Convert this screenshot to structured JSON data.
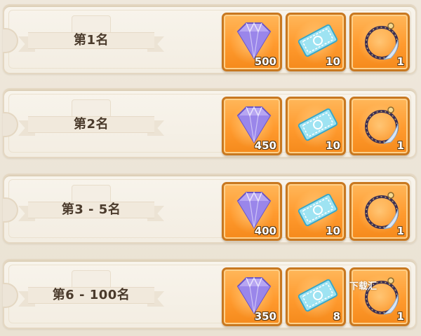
{
  "tiers": [
    {
      "rank": "第1名",
      "rewards": [
        {
          "item": "gem",
          "icon": "crystal-gem-icon",
          "quantity": "500"
        },
        {
          "item": "ticket",
          "icon": "ticket-icon",
          "quantity": "10"
        },
        {
          "item": "charm",
          "icon": "ring-charm-icon",
          "quantity": "1"
        }
      ]
    },
    {
      "rank": "第2名",
      "rewards": [
        {
          "item": "gem",
          "icon": "crystal-gem-icon",
          "quantity": "450"
        },
        {
          "item": "ticket",
          "icon": "ticket-icon",
          "quantity": "10"
        },
        {
          "item": "charm",
          "icon": "ring-charm-icon",
          "quantity": "1"
        }
      ]
    },
    {
      "rank": "第3 - 5名",
      "rewards": [
        {
          "item": "gem",
          "icon": "crystal-gem-icon",
          "quantity": "400"
        },
        {
          "item": "ticket",
          "icon": "ticket-icon",
          "quantity": "10"
        },
        {
          "item": "charm",
          "icon": "ring-charm-icon",
          "quantity": "1"
        }
      ]
    },
    {
      "rank": "第6 - 100名",
      "rewards": [
        {
          "item": "gem",
          "icon": "crystal-gem-icon",
          "quantity": "350"
        },
        {
          "item": "ticket",
          "icon": "ticket-icon",
          "quantity": "8"
        },
        {
          "item": "charm",
          "icon": "ring-charm-icon",
          "quantity": "1"
        }
      ]
    }
  ],
  "watermark": "下载汇",
  "colors": {
    "frame": "#c87820",
    "slot": "#ff9a2e",
    "label": "#4b3b2c"
  }
}
